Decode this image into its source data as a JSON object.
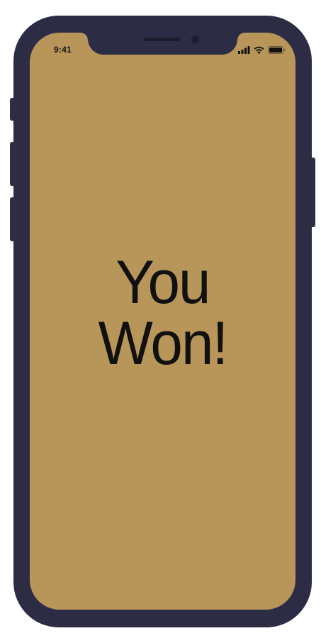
{
  "status_bar": {
    "time": "9:41",
    "icons": [
      "signal-icon",
      "wifi-icon",
      "battery-icon"
    ]
  },
  "screen": {
    "background_color": "#b8965a",
    "message_line_1": "You",
    "message_line_2": "Won!"
  },
  "device": {
    "frame_color": "#2c2d45"
  }
}
